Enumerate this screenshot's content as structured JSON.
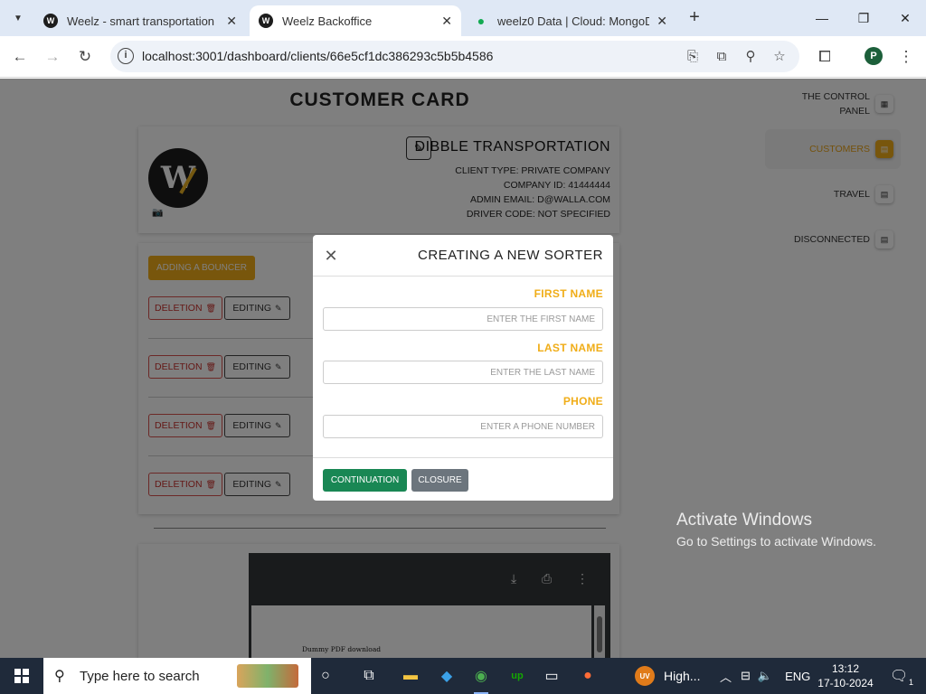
{
  "browser": {
    "tabs": [
      {
        "title": "Weelz - smart transportation",
        "favicon": "weelz-favicon"
      },
      {
        "title": "Weelz Backoffice",
        "favicon": "weelz-favicon"
      },
      {
        "title": "weelz0 Data | Cloud: MongoDB",
        "favicon": "mongodb-leaf-favicon"
      }
    ],
    "url": "localhost:3001/dashboard/clients/66e5cf1dc386293c5b5b4586",
    "profile_initial": "P"
  },
  "page": {
    "title": "CUSTOMER CARD",
    "customer": {
      "name": "DIBBLE TRANSPORTATION",
      "client_type": "CLIENT TYPE: PRIVATE COMPANY",
      "company_id": "COMPANY ID: 41444444",
      "admin_email": "ADMIN EMAIL: D@WALLA.COM",
      "driver_code": "DRIVER CODE: NOT SPECIFIED",
      "logo_letter": "W"
    },
    "bouncers": {
      "add_label": "ADDING A BOUNCER",
      "rows": [
        {
          "delete_label": "DELETION",
          "edit_label": "EDITING"
        },
        {
          "delete_label": "DELETION",
          "edit_label": "EDITING"
        },
        {
          "delete_label": "DELETION",
          "edit_label": "EDITING"
        },
        {
          "delete_label": "DELETION",
          "edit_label": "EDITING"
        }
      ]
    },
    "pdf": {
      "text": "Dummy PDF download"
    }
  },
  "sidebar": {
    "items": [
      {
        "label": "THE CONTROL PANEL",
        "icon": "dashboard-icon"
      },
      {
        "label": "CUSTOMERS",
        "icon": "id-card-icon",
        "active": true
      },
      {
        "label": "TRAVEL",
        "icon": "id-card-icon"
      },
      {
        "label": "DISCONNECTED",
        "icon": "id-card-icon"
      }
    ]
  },
  "modal": {
    "title": "CREATING A NEW SORTER",
    "fields": [
      {
        "label": "FIRST NAME",
        "placeholder": "ENTER THE FIRST NAME"
      },
      {
        "label": "LAST NAME",
        "placeholder": "ENTER THE LAST NAME"
      },
      {
        "label": "PHONE",
        "placeholder": "ENTER A PHONE NUMBER"
      }
    ],
    "continue_label": "CONTINUATION",
    "closure_label": "CLOSURE"
  },
  "watermark": {
    "line1": "Activate Windows",
    "line2": "Go to Settings to activate Windows."
  },
  "taskbar": {
    "search_placeholder": "Type here to search",
    "running_app_label": "High...",
    "running_app_badge": "UV",
    "language": "ENG",
    "time": "13:12",
    "date": "17-10-2024",
    "notification_count": "1"
  },
  "colors": {
    "accent": "#f0ad18",
    "continue": "#198754",
    "closure": "#6c757d",
    "delete": "#d9534f"
  }
}
